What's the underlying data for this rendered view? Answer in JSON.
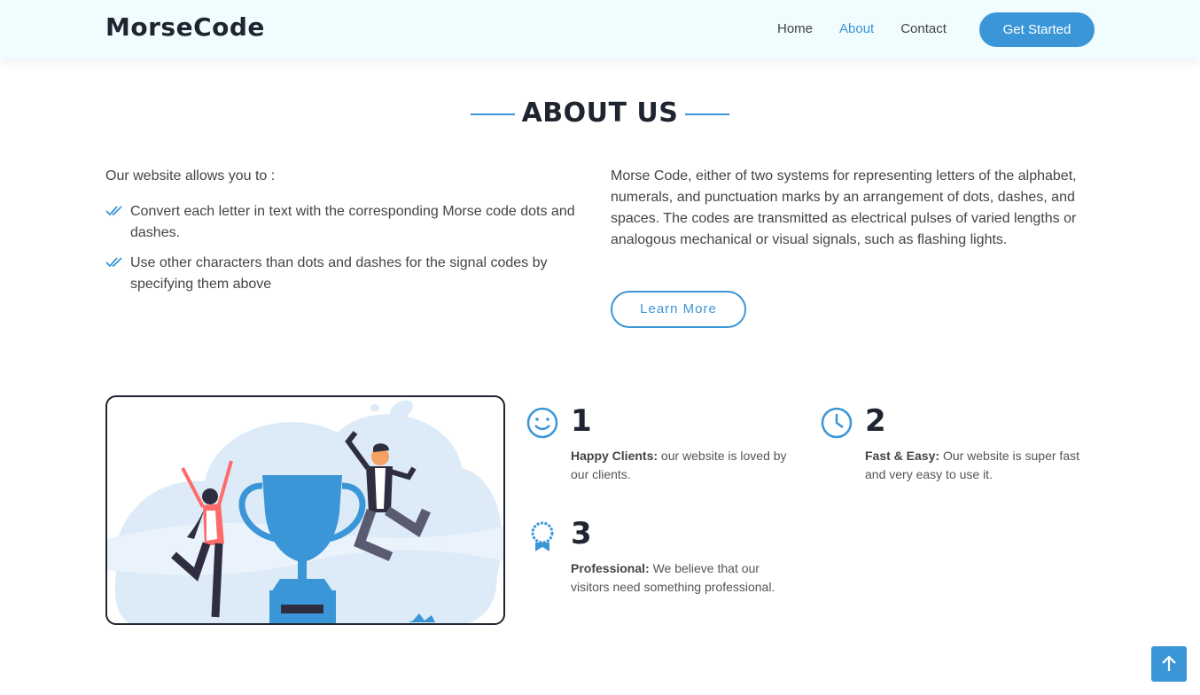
{
  "header": {
    "logo": "MorseCode",
    "nav": [
      {
        "label": "Home",
        "active": false
      },
      {
        "label": "About",
        "active": true
      },
      {
        "label": "Contact",
        "active": false
      }
    ],
    "cta_label": "Get Started"
  },
  "about": {
    "title": "ABOUT US",
    "intro": "Our website allows you to :",
    "list": [
      "Convert each letter in text with the corresponding Morse code dots and dashes.",
      "Use other characters than dots and dashes for the signal codes by specifying them above"
    ],
    "paragraph": "Morse Code, either of two systems for representing letters of the alphabet, numerals, and punctuation marks by an arrangement of dots, dashes, and spaces. The codes are transmitted as electrical pulses of varied lengths or analogous mechanical or visual signals, such as flashing lights.",
    "learn_more": "Learn More"
  },
  "counts": [
    {
      "icon": "smile-icon",
      "number": "1",
      "label": "Happy Clients:",
      "text": "our website is loved by our clients."
    },
    {
      "icon": "clock-icon",
      "number": "2",
      "label": "Fast & Easy:",
      "text": "Our website is super fast and very easy to use it."
    },
    {
      "icon": "award-icon",
      "number": "3",
      "label": "Professional:",
      "text": "We believe that our visitors need something professional."
    }
  ],
  "colors": {
    "accent": "#3b96d8",
    "header_bg": "#f0fcfe",
    "dark": "#1e2530",
    "illustration_bg": "#dcebf7"
  }
}
